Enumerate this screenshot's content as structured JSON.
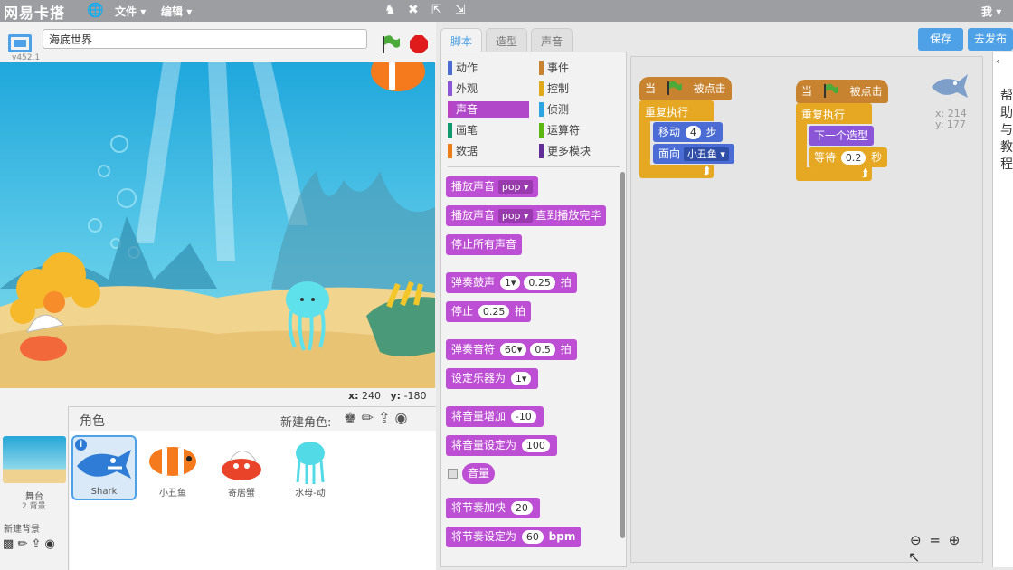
{
  "app": {
    "logo": "网易卡搭",
    "version": "v452.1"
  },
  "menu": {
    "file": "文件",
    "edit": "编辑",
    "me": "我"
  },
  "project": {
    "name": "海底世界"
  },
  "stage": {
    "x_label": "x:",
    "x": "240",
    "y_label": "y:",
    "y": "-180"
  },
  "sprites_header": {
    "title": "角色",
    "new_sprite": "新建角色:"
  },
  "stage_col": {
    "label": "舞台",
    "backdrops": "2 背景",
    "new_backdrop": "新建背景"
  },
  "sprites": [
    "Shark",
    "小丑鱼",
    "寄居蟹",
    "水母-动"
  ],
  "tabs": [
    "脚本",
    "造型",
    "声音"
  ],
  "buttons": {
    "save": "保存",
    "publish": "去发布"
  },
  "categories": [
    {
      "label": "动作",
      "color": "#4a6cd4"
    },
    {
      "label": "事件",
      "color": "#c88330"
    },
    {
      "label": "外观",
      "color": "#8a55d7"
    },
    {
      "label": "控制",
      "color": "#e1a91a"
    },
    {
      "label": "声音",
      "color": "#bb42c3"
    },
    {
      "label": "侦测",
      "color": "#2ca5e2"
    },
    {
      "label": "画笔",
      "color": "#0e9a6c"
    },
    {
      "label": "运算符",
      "color": "#5cb712"
    },
    {
      "label": "数据",
      "color": "#ee7d16"
    },
    {
      "label": "更多模块",
      "color": "#632d99"
    }
  ],
  "blocks": {
    "play_sound": "播放声音",
    "pop": "pop",
    "play_until": "直到播放完毕",
    "stop_all": "停止所有声音",
    "play_drum": "弹奏鼓声",
    "drum_num": "1",
    "beats": "拍",
    "drum_beats": "0.25",
    "rest": "停止",
    "rest_beats": "0.25",
    "play_note": "弹奏音符",
    "note": "60",
    "note_beats": "0.5",
    "set_instrument": "设定乐器为",
    "instrument": "1",
    "change_volume": "将音量增加",
    "volume_delta": "-10",
    "set_volume": "将音量设定为",
    "volume": "100",
    "volume_reporter": "音量",
    "change_tempo": "将节奏加快",
    "tempo_delta": "20",
    "set_tempo": "将节奏设定为",
    "tempo": "60",
    "bpm": "bpm"
  },
  "script1": {
    "when": "当",
    "clicked": "被点击",
    "forever": "重复执行",
    "move": "移动",
    "steps_val": "4",
    "steps": "步",
    "point": "面向",
    "target": "小丑鱼"
  },
  "script2": {
    "when": "当",
    "clicked": "被点击",
    "forever": "重复执行",
    "next_costume": "下一个造型",
    "wait": "等待",
    "wait_val": "0.2",
    "secs": "秒"
  },
  "sprite_pos": {
    "x_label": "x:",
    "x": "214",
    "y_label": "y:",
    "y": "177"
  },
  "help_text": "帮助与教程"
}
